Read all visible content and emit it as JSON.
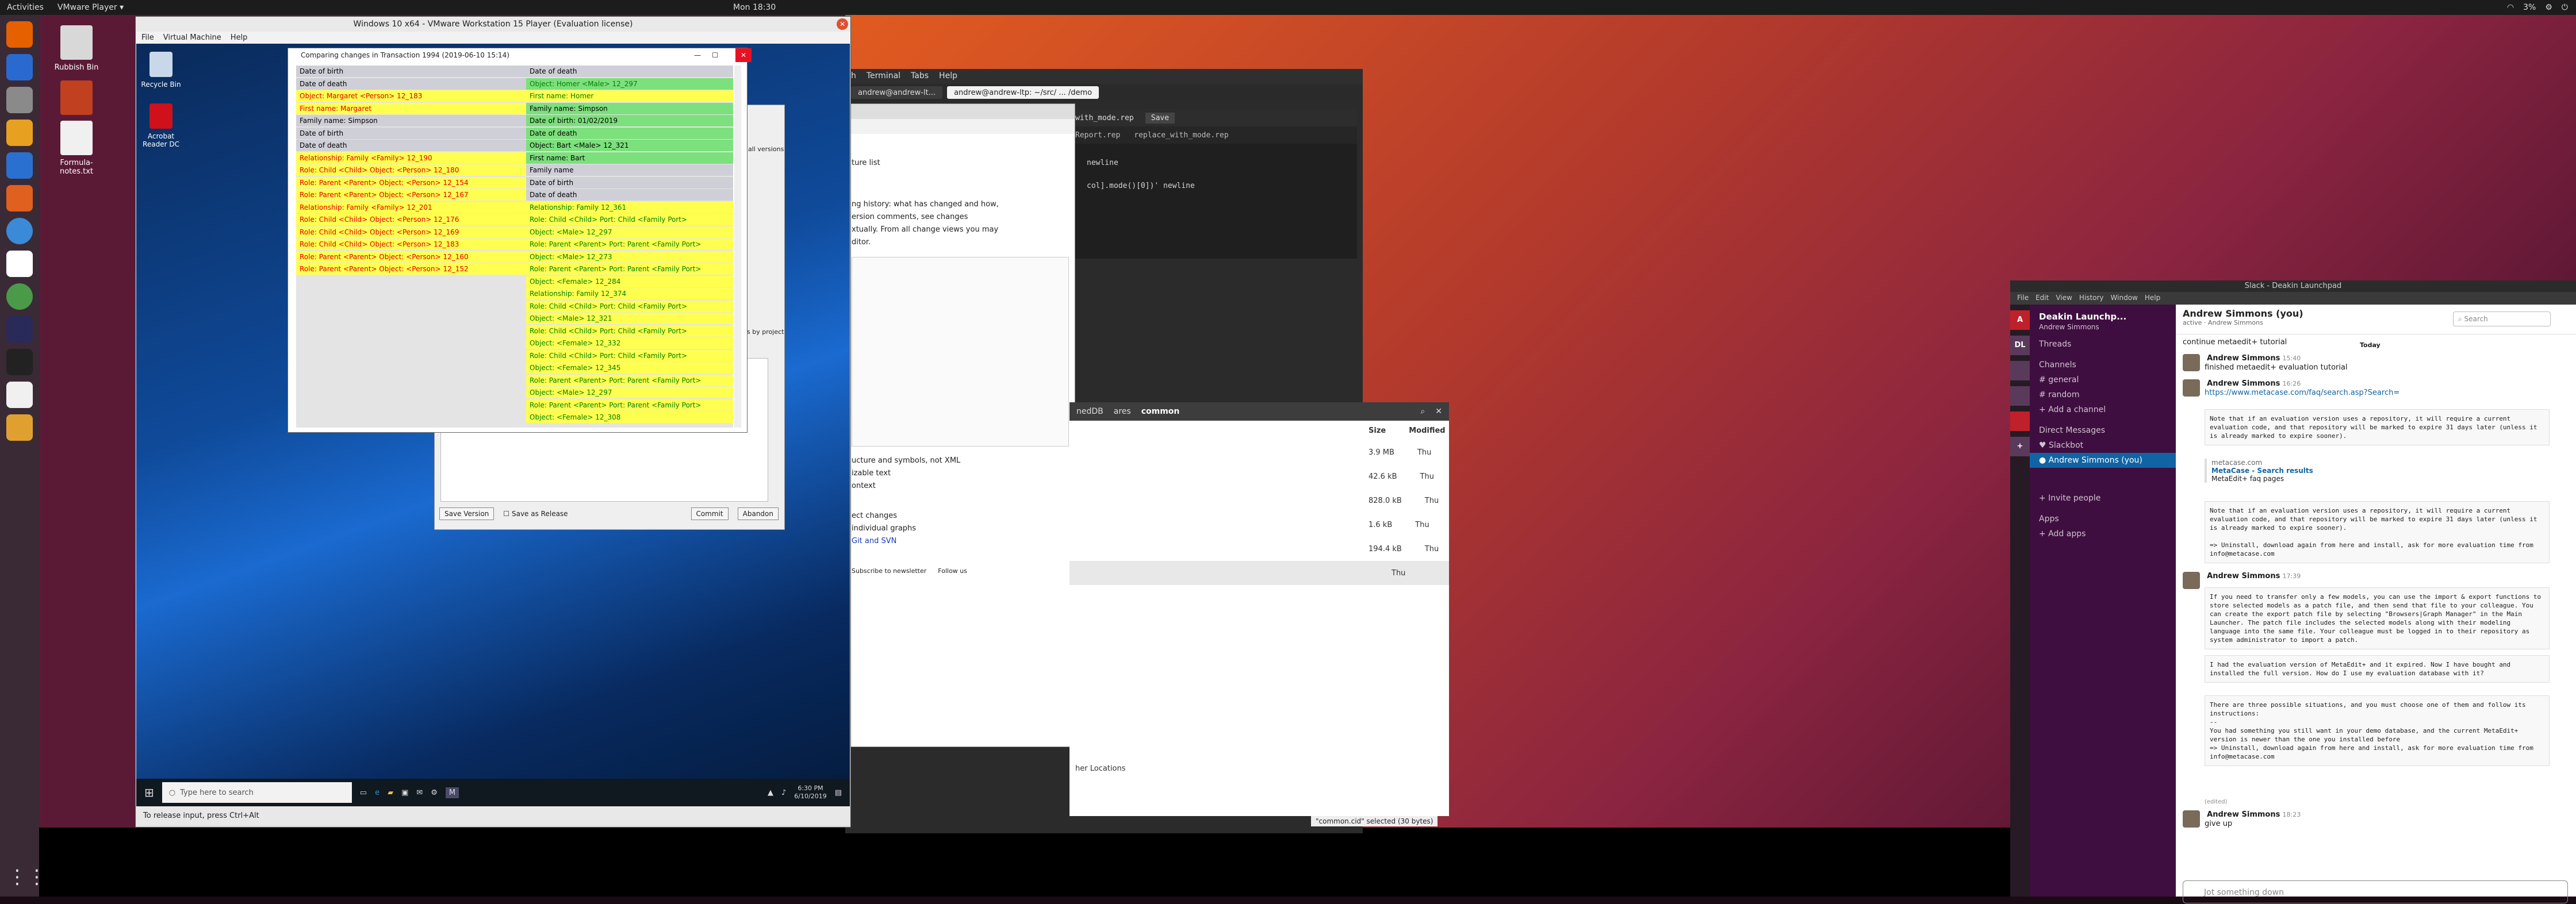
{
  "topbar": {
    "activities": "Activities",
    "app": "VMware Player ▾",
    "clock": "Mon 18:30",
    "battery": "3%"
  },
  "launcher": {
    "apps": [
      "firefox-icon",
      "thunderbird-icon",
      "files-icon",
      "rhythmbox-icon",
      "libreoffice-writer-icon",
      "software-center-icon",
      "help-icon",
      "slack-icon",
      "chrome-icon",
      "eclipse-icon",
      "terminal-icon",
      "text-editor-icon",
      "vmware-icon"
    ]
  },
  "desktop": {
    "icons": [
      {
        "label": "Rubbish Bin",
        "icon": "trash-icon"
      },
      {
        "label": "Formula-notes.txt",
        "icon": "text-file-icon"
      }
    ]
  },
  "vmware": {
    "title": "Windows 10 x64 - VMware Workstation 15 Player (Evaluation license)",
    "menu": [
      "File",
      "Virtual Machine",
      "Help"
    ],
    "status": "To release input, press Ctrl+Alt"
  },
  "win10": {
    "icons": [
      {
        "label": "Recycle Bin",
        "icon": "recycle-bin-icon"
      },
      {
        "label": "Acrobat Reader DC",
        "icon": "acrobat-icon"
      }
    ],
    "search_placeholder": "Type here to search",
    "time": "6:30 PM",
    "date": "6/10/2019"
  },
  "compare": {
    "title": "Comparing changes in Transaction 1994 (2019-06-10 15:14)",
    "close_tooltip": "Close",
    "left_rows": [
      {
        "t": "Date of birth",
        "c": "blk",
        "bg": "gr"
      },
      {
        "t": "Date of death",
        "c": "blk",
        "bg": "gr"
      },
      {
        "t": "Object: Margaret <Person> 12_183",
        "c": "red",
        "bg": "y"
      },
      {
        "t": "First name: Margaret",
        "c": "red",
        "bg": "y"
      },
      {
        "t": "Family name: Simpson",
        "c": "blk",
        "bg": "gr"
      },
      {
        "t": "Date of birth",
        "c": "blk",
        "bg": "gr"
      },
      {
        "t": "Date of death",
        "c": "blk",
        "bg": "gr"
      },
      {
        "t": "Relationship: Family <Family> 12_190",
        "c": "red",
        "bg": "y"
      },
      {
        "t": "Role: Child <Child>  Object: <Person> 12_180",
        "c": "red",
        "bg": "y"
      },
      {
        "t": "Role: Parent <Parent>  Object: <Person> 12_154",
        "c": "red",
        "bg": "y"
      },
      {
        "t": "Role: Parent <Parent>  Object: <Person> 12_167",
        "c": "red",
        "bg": "y"
      },
      {
        "t": "Relationship: Family <Family> 12_201",
        "c": "red",
        "bg": "y"
      },
      {
        "t": "Role: Child <Child>  Object: <Person> 12_176",
        "c": "red",
        "bg": "y"
      },
      {
        "t": "Role: Child <Child>  Object: <Person> 12_169",
        "c": "red",
        "bg": "y"
      },
      {
        "t": "Role: Child <Child>  Object: <Person> 12_183",
        "c": "red",
        "bg": "y"
      },
      {
        "t": "Role: Parent <Parent>  Object: <Person> 12_160",
        "c": "red",
        "bg": "y"
      },
      {
        "t": "Role: Parent <Parent>  Object: <Person> 12_152",
        "c": "red",
        "bg": "y"
      }
    ],
    "right_rows": [
      {
        "t": "Date of death",
        "c": "blk",
        "bg": "gr"
      },
      {
        "t": "Object: Homer <Male> 12_297",
        "c": "grn",
        "bg": "g"
      },
      {
        "t": "First name: Homer",
        "c": "grn",
        "bg": "y"
      },
      {
        "t": "Family name: Simpson",
        "c": "blk",
        "bg": "g"
      },
      {
        "t": "Date of birth: 01/02/2019",
        "c": "blk",
        "bg": "g"
      },
      {
        "t": "Date of death",
        "c": "blk",
        "bg": "g"
      },
      {
        "t": "Object: Bart <Male> 12_321",
        "c": "blk",
        "bg": "g"
      },
      {
        "t": "First name: Bart",
        "c": "blk",
        "bg": "g"
      },
      {
        "t": "Family name",
        "c": "blk",
        "bg": "gr"
      },
      {
        "t": "Date of birth",
        "c": "blk",
        "bg": "gr"
      },
      {
        "t": "Date of death",
        "c": "blk",
        "bg": "gr"
      },
      {
        "t": "Relationship: Family 12_361",
        "c": "grn",
        "bg": "y"
      },
      {
        "t": "Role: Child <Child>  Port: Child <Family Port>",
        "c": "grn",
        "bg": "y"
      },
      {
        "t": "Object: <Male> 12_297",
        "c": "grn",
        "bg": "y"
      },
      {
        "t": "Role: Parent <Parent>  Port: Parent <Family Port>",
        "c": "grn",
        "bg": "y"
      },
      {
        "t": "Object: <Male> 12_273",
        "c": "grn",
        "bg": "y"
      },
      {
        "t": "Role: Parent <Parent>  Port: Parent <Family Port>",
        "c": "grn",
        "bg": "y"
      },
      {
        "t": "Object: <Female> 12_284",
        "c": "grn",
        "bg": "y"
      },
      {
        "t": "Relationship: Family 12_374",
        "c": "grn",
        "bg": "y"
      },
      {
        "t": "Role: Child <Child>  Port: Child <Family Port>",
        "c": "grn",
        "bg": "y"
      },
      {
        "t": "Object: <Male> 12_321",
        "c": "grn",
        "bg": "y"
      },
      {
        "t": "Role: Child <Child>  Port: Child <Family Port>",
        "c": "grn",
        "bg": "y"
      },
      {
        "t": "Object: <Female> 12_332",
        "c": "grn",
        "bg": "y"
      },
      {
        "t": "Role: Child <Child>  Port: Child <Family Port>",
        "c": "grn",
        "bg": "y"
      },
      {
        "t": "Object: <Female> 12_345",
        "c": "grn",
        "bg": "y"
      },
      {
        "t": "Role: Parent <Parent>  Port: Parent <Family Port>",
        "c": "grn",
        "bg": "y"
      },
      {
        "t": "Object: <Male> 12_297",
        "c": "grn",
        "bg": "y"
      },
      {
        "t": "Role: Parent <Parent>  Port: Parent <Family Port>",
        "c": "grn",
        "bg": "y"
      },
      {
        "t": "Object: <Female> 12_308",
        "c": "grn",
        "bg": "y"
      }
    ]
  },
  "metaedit": {
    "save_version": "Save Version",
    "save_as_release": "Save as Release",
    "commit": "Commit",
    "abandon": "Abandon",
    "all_versions": "all versions",
    "by_project": "ls by project"
  },
  "terminal": {
    "menu": [
      "h",
      "Terminal",
      "Tabs",
      "Help"
    ],
    "tabs": [
      "andrew@andrew-lt...",
      "andrew@andrew-ltp: ~/src/ ... /demo"
    ],
    "editor_tabs": [
      "Report.rep",
      "replace_with_mode.rep"
    ],
    "editor_file": "with_mode.rep",
    "editor_save": "Save",
    "code": [
      "newline",
      "col].mode()[0])' newline"
    ]
  },
  "browser": {
    "texts": [
      "ture list",
      "ng history: what has changed and how,",
      "ersion comments, see changes",
      "xtually. From all change views you may",
      "ditor.",
      "ucture and symbols, not XML",
      "izable text",
      "ontext",
      "ect changes",
      "individual graphs",
      "Git  and  SVN",
      "Subscribe to newsletter",
      "Follow us"
    ]
  },
  "filemgr": {
    "tabs": [
      "nedDB",
      "ares",
      "common"
    ],
    "col_size": "Size",
    "col_modified": "Modified",
    "rows": [
      {
        "size": "3.9 MB",
        "mod": "Thu"
      },
      {
        "size": "42.6 kB",
        "mod": "Thu"
      },
      {
        "size": "828.0 kB",
        "mod": "Thu"
      },
      {
        "size": "1.6 kB",
        "mod": "Thu"
      },
      {
        "size": "194.4 kB",
        "mod": "Thu"
      },
      {
        "size": "",
        "mod": "Thu"
      }
    ],
    "other_locations": "her Locations",
    "status": "\"common.cid\" selected (30 bytes)"
  },
  "slack": {
    "title": "Slack - Deakin Launchpad",
    "menu": [
      "File",
      "Edit",
      "View",
      "History",
      "Window",
      "Help"
    ],
    "workspace": "Deakin Launchp...",
    "user": "Andrew Simmons",
    "threads": "Threads",
    "channels_label": "Channels",
    "channels": [
      "general",
      "random"
    ],
    "add_channel": "+ Add a channel",
    "dm_label": "Direct Messages",
    "dms": [
      "Slackbot",
      "Andrew Simmons (you)"
    ],
    "invite": "+ Invite people",
    "apps_label": "Apps",
    "add_apps": "+ Add apps",
    "header_name": "Andrew Simmons (you)",
    "header_sub": "active · Andrew Simmons",
    "search_placeholder": "Search",
    "today": "Today",
    "messages": {
      "m0": "continue metaedit+ tutorial",
      "a1": "Andrew Simmons",
      "t1": "15:40",
      "m1": "finished metaedit+ evaluation tutorial",
      "a2": "Andrew Simmons",
      "t2": "16:26",
      "link": "https://www.metacase.com/faq/search.asp?Search=",
      "code1": "Note that if an evaluation version uses a repository, it will require a current evaluation code, and that repository will be marked to expire 31 days later (unless it is already marked to expire sooner).",
      "unfurl_site": "metacase.com",
      "unfurl_title": "MetaCase - Search results",
      "unfurl_desc": "MetaEdit+ faq pages",
      "code2": "Note that if an evaluation version uses a repository, it will require a current evaluation code, and that repository will be marked to expire 31 days later (unless it is already marked to expire sooner).\n\n=> Uninstall, download again from here and install, ask for more evaluation time from info@metacase.com",
      "a3": "Andrew Simmons",
      "t3": "17:39",
      "code3": "If you need to transfer only a few models, you can use the import & export functions to store selected models as a patch file, and then send that file to your colleague. You can create the export patch file by selecting \"Browsers|Graph Manager\" in the Main Launcher. The patch file includes the selected models along with their modeling language into the same file. Your colleague must be logged in to their repository as system administrator to import a patch.",
      "code4": "I had the evaluation version of MetaEdit+ and it expired. Now I have bought and installed the full version. How do I use my evaluation database with it?",
      "code5": "There are three possible situations, and you must choose one of them and follow its instructions:\n--\nYou had something you still want in your demo database, and the current MetaEdit+ version is newer than the one you installed before\n=> Uninstall, download again from here and install, ask for more evaluation time from info@metacase.com",
      "edited": "(edited)",
      "a4": "Andrew Simmons",
      "t4": "18:23",
      "m4": "give up"
    },
    "input_placeholder": "Jot something down"
  }
}
